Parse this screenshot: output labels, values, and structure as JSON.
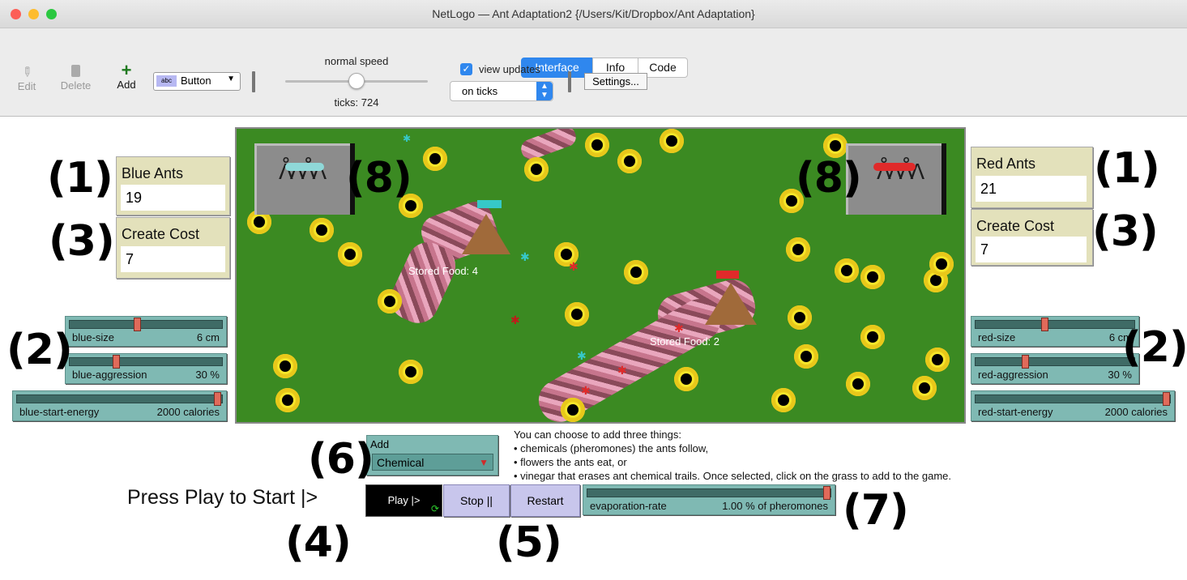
{
  "window": {
    "title": "NetLogo — Ant Adaptation2 {/Users/Kit/Dropbox/Ant Adaptation}"
  },
  "tabs": [
    "Interface",
    "Info",
    "Code"
  ],
  "toolbar": {
    "edit": "Edit",
    "delete": "Delete",
    "add": "Add",
    "widget_type": "Button",
    "speed_label": "normal speed",
    "ticks": "ticks: 724",
    "view_updates": "view updates",
    "update_mode": "on ticks",
    "settings": "Settings..."
  },
  "blue": {
    "ants_label": "Blue Ants",
    "ants_value": "19",
    "cost_label": "Create Cost",
    "cost_value": "7",
    "size_name": "blue-size",
    "size_value": "6 cm",
    "aggr_name": "blue-aggression",
    "aggr_value": "30 %",
    "energy_name": "blue-start-energy",
    "energy_value": "2000 calories"
  },
  "red": {
    "ants_label": "Red Ants",
    "ants_value": "21",
    "cost_label": "Create Cost",
    "cost_value": "7",
    "size_name": "red-size",
    "size_value": "6 cm",
    "aggr_name": "red-aggression",
    "aggr_value": "30 %",
    "energy_name": "red-start-energy",
    "energy_value": "2000 calories"
  },
  "view": {
    "blue_food": "Stored Food: 4",
    "red_food": "Stored Food: 2"
  },
  "controls": {
    "add_label": "Add",
    "add_value": "Chemical",
    "press_play": "Press Play to Start |>",
    "play": "Play |>",
    "stop": "Stop ||",
    "restart": "Restart",
    "evap_name": "evaporation-rate",
    "evap_value": "1.00 % of pheromones"
  },
  "info": {
    "line1": "You can choose to add three things:",
    "line2": "• chemicals (pheromones) the ants follow,",
    "line3": "• flowers the ants eat, or",
    "line4": "• vinegar that erases ant chemical trails. Once selected, click on the grass to add to the game."
  },
  "annotations": {
    "one": "(1)",
    "two": "(2)",
    "three": "(3)",
    "four": "(4)",
    "five": "(5)",
    "six": "(6)",
    "seven": "(7)",
    "eight": "(8)"
  },
  "slider_levels": {
    "blue_size": 0.45,
    "blue_aggression": 0.3,
    "blue_start_energy": 1.0,
    "red_size": 0.45,
    "red_aggression": 0.3,
    "red_start_energy": 1.0,
    "evaporation_rate": 1.0,
    "speed": 0.5
  },
  "colors": {
    "grass": "#3b8a22",
    "monitor": "#e3e1bb",
    "slider": "#7fb9b3",
    "button": "#c8c6ec",
    "accent": "#2f87ee"
  }
}
